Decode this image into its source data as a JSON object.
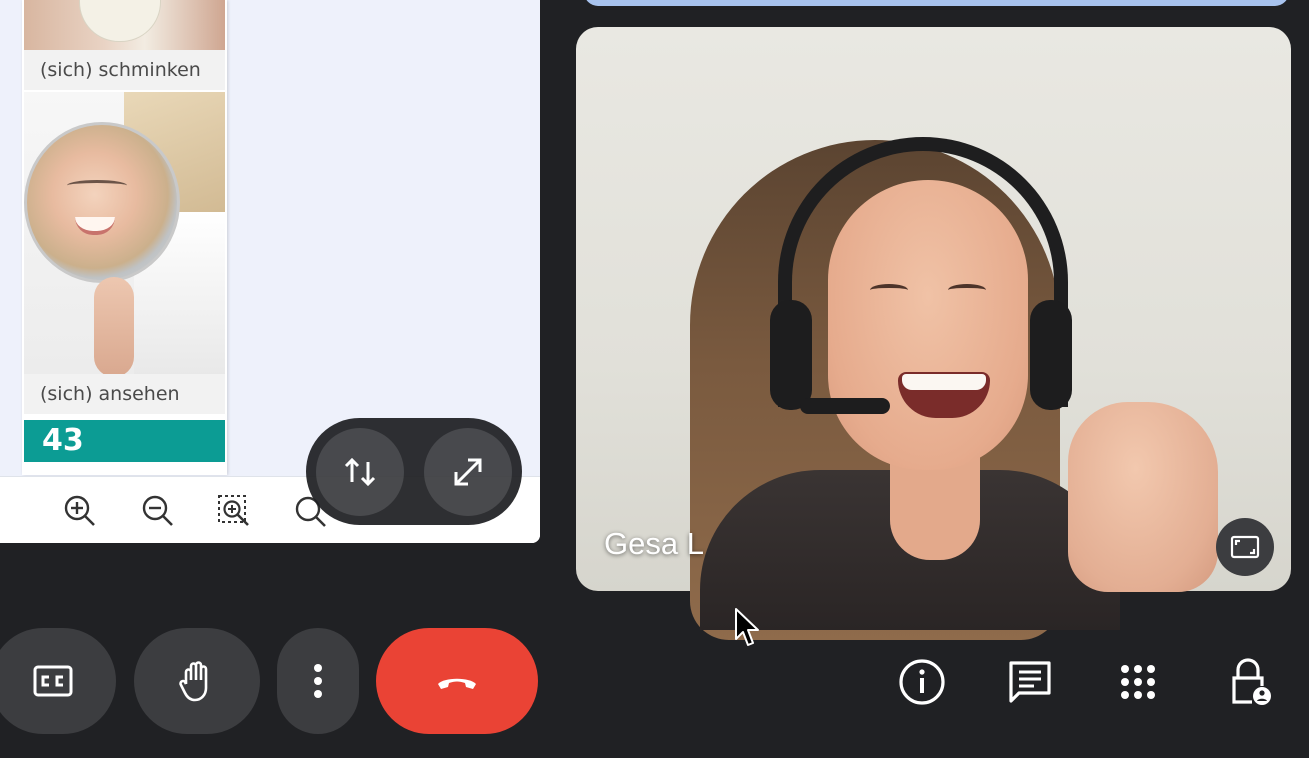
{
  "document": {
    "caption_1": "(sich) schminken",
    "caption_2": "(sich) ansehen",
    "chapter_number": "43"
  },
  "toolbar": {
    "zoom_in": "zoom-in",
    "zoom_out": "zoom-out",
    "zoom_fit": "zoom-fit",
    "search": "search"
  },
  "overlay": {
    "swap": "swap",
    "expand": "expand"
  },
  "participant": {
    "name": "Gesa L"
  },
  "controls": {
    "captions": "captions",
    "raise_hand": "raise hand",
    "more_options": "more options",
    "end_call": "leave call"
  },
  "right_controls": {
    "info": "meeting details",
    "chat": "chat",
    "activities": "activities",
    "host_controls": "host controls"
  },
  "colors": {
    "background": "#202124",
    "end_call": "#ea4335",
    "chapter_band": "#0c9c94",
    "control_button": "#3c3d40",
    "top_strip": "#a8c3ee"
  }
}
